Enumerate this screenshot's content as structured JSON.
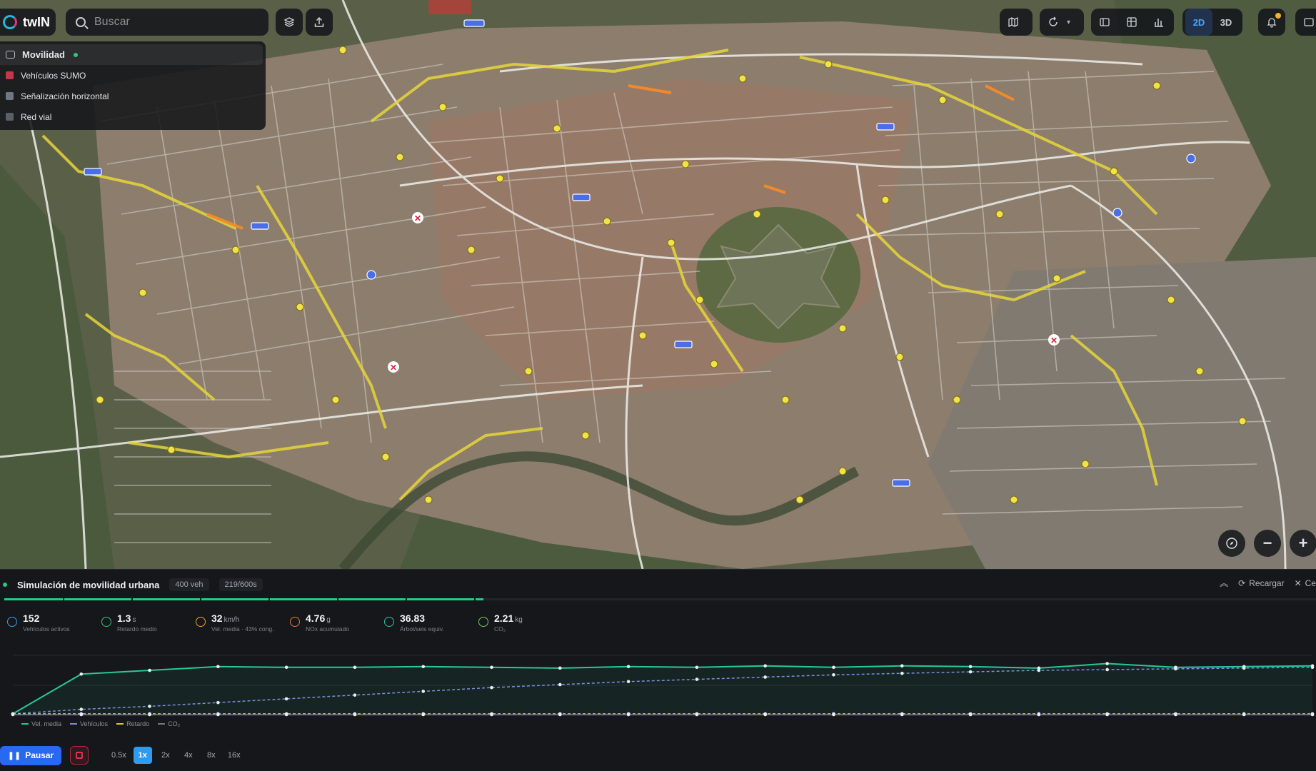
{
  "app": {
    "name": "twIN"
  },
  "search": {
    "placeholder": "Buscar"
  },
  "layers": {
    "items": [
      {
        "label": "Movilidad",
        "active": true,
        "swatch": "#b9bdc3"
      },
      {
        "label": "Vehículos SUMO",
        "swatch": "#c0394b"
      },
      {
        "label": "Señalización horizontal",
        "swatch": "#6f7780"
      },
      {
        "label": "Red vial",
        "swatch": "#5a6068"
      }
    ]
  },
  "toolbar": {
    "mode_2d": "2D",
    "mode_3d": "3D",
    "active_mode": "2D"
  },
  "simulation": {
    "title": "Simulación de movilidad urbana",
    "vehicles_pill": "400 veh",
    "time_pill": "219/600s",
    "reload_label": "Recargar",
    "close_label": "Ce",
    "progress": 0.365
  },
  "metrics": [
    {
      "value": "152",
      "unit": "",
      "label": "Vehículos activos",
      "color": "#3da0e6"
    },
    {
      "value": "1.3",
      "unit": "s",
      "label": "Retardo medio",
      "color": "#2ec67a"
    },
    {
      "value": "32",
      "unit": "km/h",
      "label": "Vel. media · 43% cong.",
      "color": "#f0a030"
    },
    {
      "value": "4.76",
      "unit": "g",
      "label": "NOx acumulado",
      "color": "#e07a3a"
    },
    {
      "value": "36.83",
      "unit": "",
      "label": "Árbol/seis equiv.",
      "color": "#2ec6a0"
    },
    {
      "value": "2.21",
      "unit": "kg",
      "label": "CO₂",
      "color": "#7ac65a"
    }
  ],
  "chart_data": {
    "type": "line",
    "x": [
      0,
      1,
      2,
      3,
      4,
      5,
      6,
      7,
      8,
      9,
      10,
      11,
      12,
      13,
      14,
      15,
      16,
      17,
      18,
      19
    ],
    "series": [
      {
        "name": "Vel. media",
        "color": "#27c79a",
        "values": [
          2,
          55,
          60,
          65,
          64,
          64,
          65,
          64,
          63,
          65,
          64,
          66,
          64,
          66,
          65,
          63,
          69,
          64,
          65,
          66
        ]
      },
      {
        "name": "Vehículos",
        "color": "#7a8fd6",
        "values": [
          2,
          8,
          12,
          17,
          22,
          27,
          32,
          37,
          41,
          45,
          48,
          51,
          54,
          56,
          58,
          60,
          61,
          62,
          63,
          64
        ]
      },
      {
        "name": "Retardo",
        "color": "#d6c934",
        "values": [
          2,
          2,
          2,
          2,
          2,
          2,
          2,
          2,
          2,
          2,
          2,
          2,
          2,
          2,
          2,
          2,
          2,
          2,
          2,
          2
        ]
      },
      {
        "name": "CO₂",
        "color": "#6d7a86",
        "values": [
          1,
          1,
          1,
          1,
          1,
          1,
          1,
          1,
          1,
          1,
          1,
          1,
          1,
          1,
          1,
          1,
          1,
          1,
          1,
          1
        ]
      }
    ],
    "ylim": [
      0,
      80
    ],
    "grid": true,
    "legend": "bottom-left"
  },
  "playback": {
    "pause_label": "Pausar",
    "speeds": [
      "0.5x",
      "1x",
      "2x",
      "4x",
      "8x",
      "16x"
    ],
    "active_speed": "1x"
  }
}
